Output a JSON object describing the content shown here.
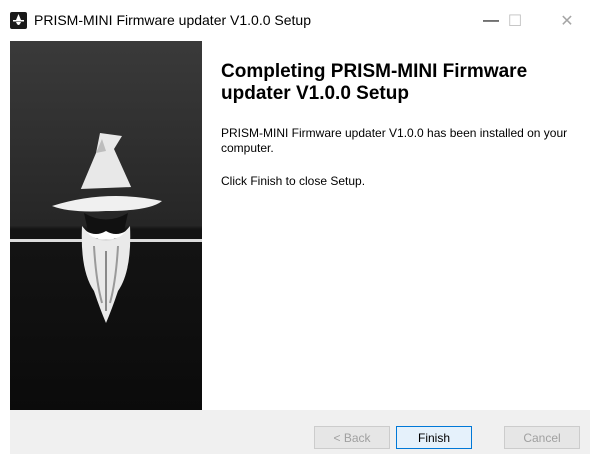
{
  "window": {
    "title": "PRISM-MINI Firmware updater V1.0.0 Setup",
    "app_icon": "prism-mini-app-icon",
    "controls": {
      "minimize_glyph": "—",
      "maximize_glyph": "☐",
      "close_glyph": "✕"
    }
  },
  "sidebar": {
    "image": "wizard-logo-icon"
  },
  "main": {
    "heading": "Completing PRISM-MINI Firmware updater V1.0.0 Setup",
    "paragraphs": [
      "PRISM-MINI Firmware updater V1.0.0 has been installed on your computer.",
      "Click Finish to close Setup."
    ]
  },
  "footer": {
    "back_label": "< Back",
    "finish_label": "Finish",
    "cancel_label": "Cancel"
  },
  "colors": {
    "accent": "#0078d7",
    "footer_bg": "#f0f0f0",
    "sidebar_dark": "#141414"
  }
}
